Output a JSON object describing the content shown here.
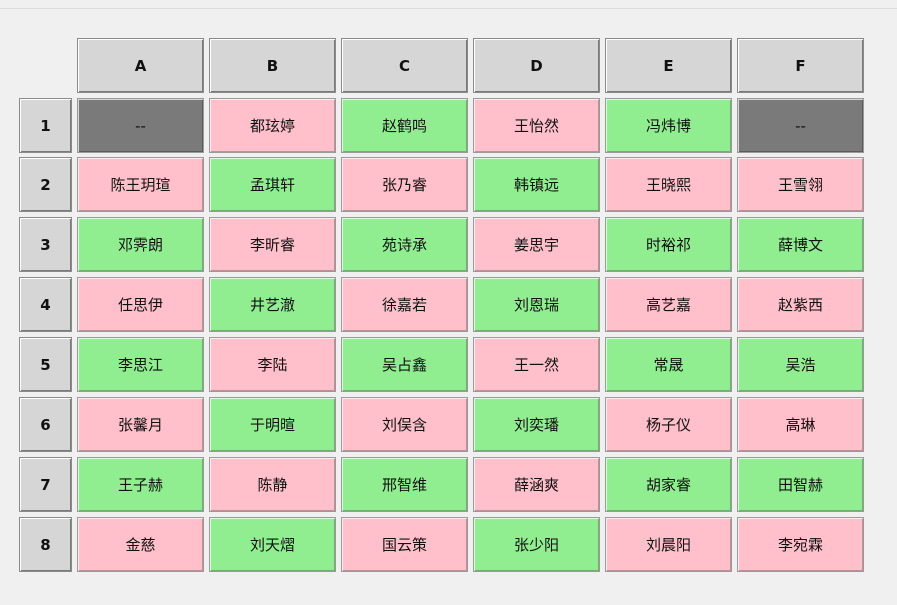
{
  "colors": {
    "pink": "#ffc0cb",
    "green": "#90ee90",
    "empty": "#7a7a7a",
    "header": "#d6d6d6",
    "panel": "#f0f0f0"
  },
  "columns": [
    "A",
    "B",
    "C",
    "D",
    "E",
    "F"
  ],
  "rows": [
    {
      "label": "1",
      "seats": [
        {
          "name": "--",
          "color": "empty"
        },
        {
          "name": "都玹婷",
          "color": "pink"
        },
        {
          "name": "赵鹤鸣",
          "color": "green"
        },
        {
          "name": "王怡然",
          "color": "pink"
        },
        {
          "name": "冯炜博",
          "color": "green"
        },
        {
          "name": "--",
          "color": "empty"
        }
      ]
    },
    {
      "label": "2",
      "seats": [
        {
          "name": "陈王玥瑄",
          "color": "pink"
        },
        {
          "name": "孟琪轩",
          "color": "green"
        },
        {
          "name": "张乃睿",
          "color": "pink"
        },
        {
          "name": "韩镇远",
          "color": "green"
        },
        {
          "name": "王晓熙",
          "color": "pink"
        },
        {
          "name": "王雪翎",
          "color": "pink"
        }
      ]
    },
    {
      "label": "3",
      "seats": [
        {
          "name": "邓霁朗",
          "color": "green"
        },
        {
          "name": "李昕睿",
          "color": "pink"
        },
        {
          "name": "苑诗承",
          "color": "green"
        },
        {
          "name": "姜思宇",
          "color": "pink"
        },
        {
          "name": "时裕祁",
          "color": "green"
        },
        {
          "name": "薛博文",
          "color": "green"
        }
      ]
    },
    {
      "label": "4",
      "seats": [
        {
          "name": "任思伊",
          "color": "pink"
        },
        {
          "name": "井艺澈",
          "color": "green"
        },
        {
          "name": "徐嘉若",
          "color": "pink"
        },
        {
          "name": "刘恩瑞",
          "color": "green"
        },
        {
          "name": "高艺嘉",
          "color": "pink"
        },
        {
          "name": "赵紫西",
          "color": "pink"
        }
      ]
    },
    {
      "label": "5",
      "seats": [
        {
          "name": "李思江",
          "color": "green"
        },
        {
          "name": "李陆",
          "color": "pink"
        },
        {
          "name": "吴占鑫",
          "color": "green"
        },
        {
          "name": "王一然",
          "color": "pink"
        },
        {
          "name": "常晟",
          "color": "green"
        },
        {
          "name": "吴浩",
          "color": "green"
        }
      ]
    },
    {
      "label": "6",
      "seats": [
        {
          "name": "张馨月",
          "color": "pink"
        },
        {
          "name": "于明暄",
          "color": "green"
        },
        {
          "name": "刘俣含",
          "color": "pink"
        },
        {
          "name": "刘奕璠",
          "color": "green"
        },
        {
          "name": "杨子仪",
          "color": "pink"
        },
        {
          "name": "高琳",
          "color": "pink"
        }
      ]
    },
    {
      "label": "7",
      "seats": [
        {
          "name": "王子赫",
          "color": "green"
        },
        {
          "name": "陈静",
          "color": "pink"
        },
        {
          "name": "邢智维",
          "color": "green"
        },
        {
          "name": "薛涵爽",
          "color": "pink"
        },
        {
          "name": "胡家睿",
          "color": "green"
        },
        {
          "name": "田智赫",
          "color": "green"
        }
      ]
    },
    {
      "label": "8",
      "seats": [
        {
          "name": "金慈",
          "color": "pink"
        },
        {
          "name": "刘天熠",
          "color": "green"
        },
        {
          "name": "国云策",
          "color": "pink"
        },
        {
          "name": "张少阳",
          "color": "green"
        },
        {
          "name": "刘晨阳",
          "color": "pink"
        },
        {
          "name": "李宛霖",
          "color": "pink"
        }
      ]
    }
  ]
}
